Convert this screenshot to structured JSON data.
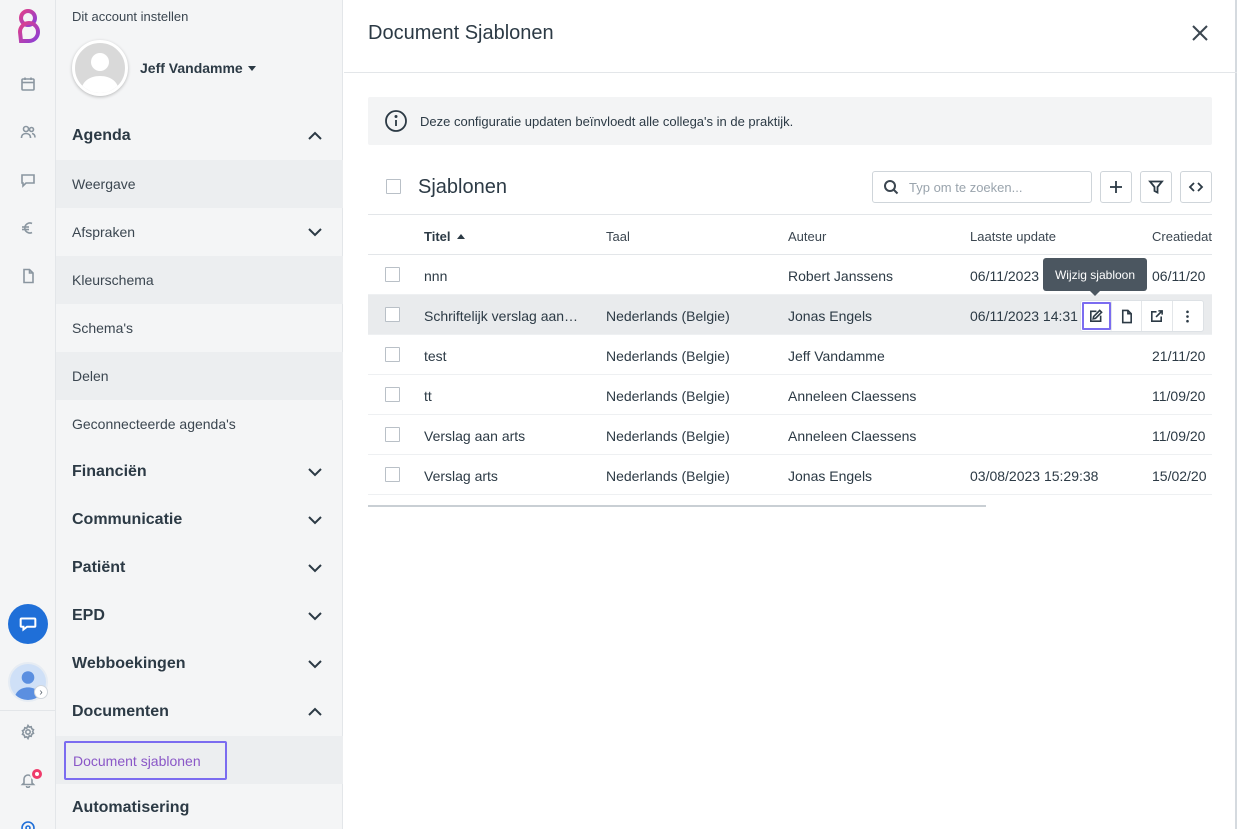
{
  "sidebar": {
    "account_label": "Dit account instellen",
    "profile_name": "Jeff Vandamme",
    "sections": [
      {
        "label": "Agenda",
        "expanded": true,
        "items": [
          "Weergave",
          "Afspraken",
          "Kleurschema",
          "Schema's",
          "Delen",
          "Geconnecteerde agenda's"
        ]
      },
      {
        "label": "Financiën",
        "expanded": false
      },
      {
        "label": "Communicatie",
        "expanded": false
      },
      {
        "label": "Patiënt",
        "expanded": false
      },
      {
        "label": "EPD",
        "expanded": false
      },
      {
        "label": "Webboekingen",
        "expanded": false
      },
      {
        "label": "Documenten",
        "expanded": true,
        "items": [
          "Document sjablonen"
        ]
      },
      {
        "label": "Automatisering",
        "expanded": false
      }
    ],
    "active_item": "Document sjablonen"
  },
  "main": {
    "title": "Document Sjablonen",
    "info_text": "Deze configuratie updaten beïnvloedt alle collega's in de praktijk.",
    "table_title": "Sjablonen",
    "search_placeholder": "Typ om te zoeken...",
    "columns": [
      "Titel",
      "Taal",
      "Auteur",
      "Laatste update",
      "Creatiedat"
    ],
    "sorted_column": "Titel",
    "rows": [
      {
        "title": "nnn",
        "taal": "",
        "auteur": "Robert Janssens",
        "update": "06/11/2023",
        "created": "06/11/20"
      },
      {
        "title": "Schriftelijk verslag aan…",
        "taal": "Nederlands (Belgie)",
        "auteur": "Jonas Engels",
        "update": "06/11/2023 14:31",
        "created": ""
      },
      {
        "title": "test",
        "taal": "Nederlands (Belgie)",
        "auteur": "Jeff Vandamme",
        "update": "",
        "created": "21/11/20"
      },
      {
        "title": "tt",
        "taal": "Nederlands (Belgie)",
        "auteur": "Anneleen Claessens",
        "update": "",
        "created": "11/09/20"
      },
      {
        "title": "Verslag aan arts",
        "taal": "Nederlands (Belgie)",
        "auteur": "Anneleen Claessens",
        "update": "",
        "created": "11/09/20"
      },
      {
        "title": "Verslag arts",
        "taal": "Nederlands (Belgie)",
        "auteur": "Jonas Engels",
        "update": "03/08/2023 15:29:38",
        "created": "15/02/20"
      }
    ],
    "tooltip": "Wijzig sjabloon"
  },
  "colors": {
    "accent": "#7b6cf0",
    "brand_purple": "#8a57c7",
    "chat_blue": "#1f6fd8",
    "notification": "#ef3b6b"
  }
}
